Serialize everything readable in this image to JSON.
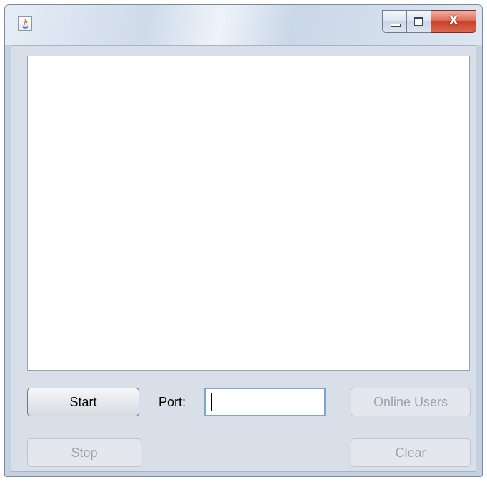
{
  "window": {
    "title": "",
    "icon": "java-icon",
    "caption": {
      "minimize": "minimize-icon",
      "maximize": "maximize-icon",
      "close_glyph": "X"
    }
  },
  "log": {
    "text": ""
  },
  "controls": {
    "start_label": "Start",
    "port_label": "Port:",
    "port_value": "",
    "online_users_label": "Online Users",
    "stop_label": "Stop",
    "clear_label": "Clear"
  },
  "states": {
    "start": "enabled",
    "online_users": "disabled",
    "stop": "disabled",
    "clear": "disabled"
  },
  "colors": {
    "focus_border": "#7aa6d1",
    "close_button": "#c8412a",
    "disabled_text": "#9aa3ad"
  }
}
